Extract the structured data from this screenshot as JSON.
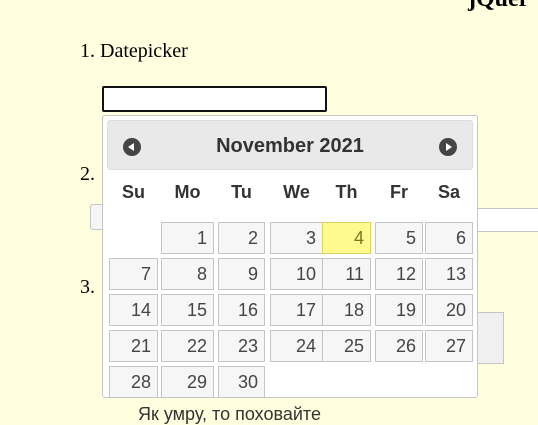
{
  "header": {
    "top_text": "jQuer"
  },
  "list": [
    {
      "number": "1.",
      "label": "Datepicker"
    },
    {
      "number": "2.",
      "label": ""
    },
    {
      "number": "3.",
      "label": ""
    }
  ],
  "datepicker": {
    "month_year": "November 2021",
    "prev_label": "Prev",
    "next_label": "Next",
    "weekdays": [
      "Su",
      "Mo",
      "Tu",
      "We",
      "Th",
      "Fr",
      "Sa"
    ],
    "weeks": [
      [
        "",
        "1",
        "2",
        "3",
        "4",
        "5",
        "6"
      ],
      [
        "7",
        "8",
        "9",
        "10",
        "11",
        "12",
        "13"
      ],
      [
        "14",
        "15",
        "16",
        "17",
        "18",
        "19",
        "20"
      ],
      [
        "21",
        "22",
        "23",
        "24",
        "25",
        "26",
        "27"
      ],
      [
        "28",
        "29",
        "30",
        "",
        "",
        "",
        ""
      ]
    ],
    "today": "4",
    "today_color": "#fffa90"
  },
  "bottom": {
    "text": "Як умру, то поховайте"
  }
}
